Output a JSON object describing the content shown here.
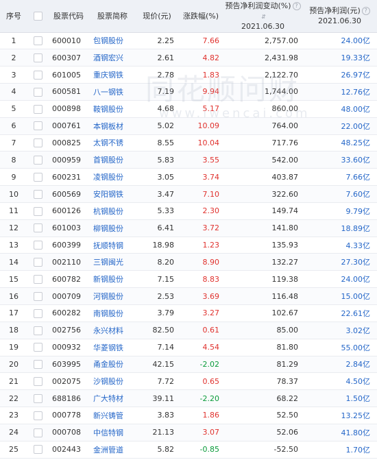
{
  "header": {
    "seq": "序号",
    "code": "股票代码",
    "name": "股票简称",
    "price": "现价(元)",
    "change": "涨跌幅(%)",
    "np_change": "预告净利润变动(%)",
    "np_change_date": "2021.06.30",
    "np": "预告净利润(元)",
    "np_date": "2021.06.30"
  },
  "watermark": {
    "main": "同花顺问财",
    "sub": "www.iwencai.com"
  },
  "rows": [
    {
      "seq": "1",
      "code": "600010",
      "name": "包钢股份",
      "price": "2.25",
      "change": "7.66",
      "np_change": "2,757.00",
      "np": "24.00亿",
      "dir": "up"
    },
    {
      "seq": "2",
      "code": "600307",
      "name": "酒钢宏兴",
      "price": "2.61",
      "change": "4.82",
      "np_change": "2,431.98",
      "np": "19.33亿",
      "dir": "up"
    },
    {
      "seq": "3",
      "code": "601005",
      "name": "重庆钢铁",
      "price": "2.78",
      "change": "1.83",
      "np_change": "2,122.70",
      "np": "26.97亿",
      "dir": "up"
    },
    {
      "seq": "4",
      "code": "600581",
      "name": "八一钢铁",
      "price": "7.19",
      "change": "9.94",
      "np_change": "1,744.00",
      "np": "12.76亿",
      "dir": "up"
    },
    {
      "seq": "5",
      "code": "000898",
      "name": "鞍钢股份",
      "price": "4.68",
      "change": "5.17",
      "np_change": "860.00",
      "np": "48.00亿",
      "dir": "up"
    },
    {
      "seq": "6",
      "code": "000761",
      "name": "本钢板材",
      "price": "5.02",
      "change": "10.09",
      "np_change": "764.00",
      "np": "22.00亿",
      "dir": "up"
    },
    {
      "seq": "7",
      "code": "000825",
      "name": "太钢不锈",
      "price": "8.55",
      "change": "10.04",
      "np_change": "717.76",
      "np": "48.25亿",
      "dir": "up"
    },
    {
      "seq": "8",
      "code": "000959",
      "name": "首钢股份",
      "price": "5.83",
      "change": "3.55",
      "np_change": "542.00",
      "np": "33.60亿",
      "dir": "up"
    },
    {
      "seq": "9",
      "code": "600231",
      "name": "凌钢股份",
      "price": "3.05",
      "change": "3.74",
      "np_change": "403.87",
      "np": "7.66亿",
      "dir": "up"
    },
    {
      "seq": "10",
      "code": "600569",
      "name": "安阳钢铁",
      "price": "3.47",
      "change": "7.10",
      "np_change": "322.60",
      "np": "7.60亿",
      "dir": "up"
    },
    {
      "seq": "11",
      "code": "600126",
      "name": "杭钢股份",
      "price": "5.33",
      "change": "2.30",
      "np_change": "149.74",
      "np": "9.79亿",
      "dir": "up"
    },
    {
      "seq": "12",
      "code": "601003",
      "name": "柳钢股份",
      "price": "6.41",
      "change": "3.72",
      "np_change": "141.80",
      "np": "18.89亿",
      "dir": "up"
    },
    {
      "seq": "13",
      "code": "600399",
      "name": "抚顺特钢",
      "price": "18.98",
      "change": "1.23",
      "np_change": "135.93",
      "np": "4.33亿",
      "dir": "up"
    },
    {
      "seq": "14",
      "code": "002110",
      "name": "三钢闽光",
      "price": "8.20",
      "change": "8.90",
      "np_change": "132.27",
      "np": "27.30亿",
      "dir": "up"
    },
    {
      "seq": "15",
      "code": "600782",
      "name": "新钢股份",
      "price": "7.15",
      "change": "8.83",
      "np_change": "119.38",
      "np": "24.00亿",
      "dir": "up"
    },
    {
      "seq": "16",
      "code": "000709",
      "name": "河钢股份",
      "price": "2.53",
      "change": "3.69",
      "np_change": "116.48",
      "np": "15.00亿",
      "dir": "up"
    },
    {
      "seq": "17",
      "code": "600282",
      "name": "南钢股份",
      "price": "3.79",
      "change": "3.27",
      "np_change": "102.67",
      "np": "22.61亿",
      "dir": "up"
    },
    {
      "seq": "18",
      "code": "002756",
      "name": "永兴材料",
      "price": "82.50",
      "change": "0.61",
      "np_change": "85.00",
      "np": "3.02亿",
      "dir": "up"
    },
    {
      "seq": "19",
      "code": "000932",
      "name": "华菱钢铁",
      "price": "7.14",
      "change": "4.54",
      "np_change": "81.80",
      "np": "55.00亿",
      "dir": "up"
    },
    {
      "seq": "20",
      "code": "603995",
      "name": "甬金股份",
      "price": "42.15",
      "change": "-2.02",
      "np_change": "81.29",
      "np": "2.84亿",
      "dir": "down"
    },
    {
      "seq": "21",
      "code": "002075",
      "name": "沙钢股份",
      "price": "7.72",
      "change": "0.65",
      "np_change": "78.37",
      "np": "4.50亿",
      "dir": "up"
    },
    {
      "seq": "22",
      "code": "688186",
      "name": "广大特材",
      "price": "39.11",
      "change": "-2.20",
      "np_change": "68.22",
      "np": "1.50亿",
      "dir": "down"
    },
    {
      "seq": "23",
      "code": "000778",
      "name": "新兴铸管",
      "price": "3.83",
      "change": "1.86",
      "np_change": "52.50",
      "np": "13.25亿",
      "dir": "up"
    },
    {
      "seq": "24",
      "code": "000708",
      "name": "中信特钢",
      "price": "21.13",
      "change": "3.07",
      "np_change": "52.06",
      "np": "41.80亿",
      "dir": "up"
    },
    {
      "seq": "25",
      "code": "002443",
      "name": "金洲管道",
      "price": "5.82",
      "change": "-0.85",
      "np_change": "-52.50",
      "np": "1.70亿",
      "dir": "down"
    }
  ],
  "colors": {
    "up": "#e0312d",
    "down": "#0a9b3a",
    "link": "#2466c8",
    "header_bg": "#eef1f6"
  },
  "icons": {
    "help": "question-circle-icon",
    "sort": "sort-icon",
    "checkbox": "checkbox"
  }
}
